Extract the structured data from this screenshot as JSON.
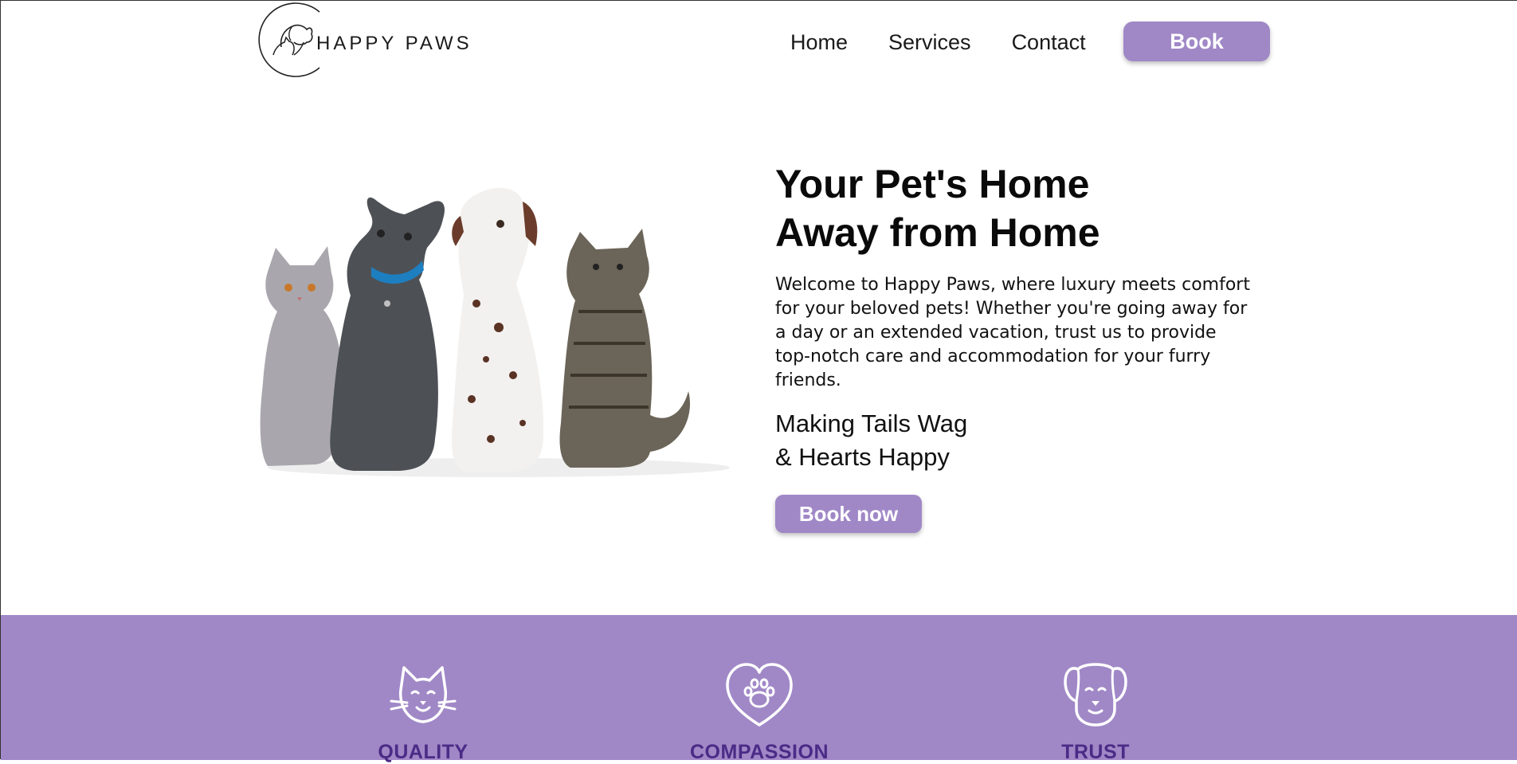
{
  "brand": {
    "name": "HAPPY PAWS",
    "logo_icon": "dog-cat-logo-icon"
  },
  "nav": {
    "home": "Home",
    "services": "Services",
    "contact": "Contact",
    "book": "Book"
  },
  "hero": {
    "title_line1": "Your Pet's Home",
    "title_line2": "Away from Home",
    "description": "Welcome to Happy Paws, where luxury meets comfort for your beloved pets! Whether you're going away for a day or an extended vacation, trust us to provide top-notch care and accommodation for your furry friends.",
    "tagline_line1": "Making Tails Wag",
    "tagline_line2": "& Hearts Happy",
    "cta": "Book now",
    "image": "cats-and-dogs-photo"
  },
  "features": [
    {
      "label": "QUALITY",
      "icon": "cat-face-icon"
    },
    {
      "label": "COMPASSION",
      "icon": "heart-paw-icon"
    },
    {
      "label": "TRUST",
      "icon": "dog-face-icon"
    }
  ],
  "colors": {
    "accent": "#a088c7",
    "feature_label": "#4a2b86"
  }
}
